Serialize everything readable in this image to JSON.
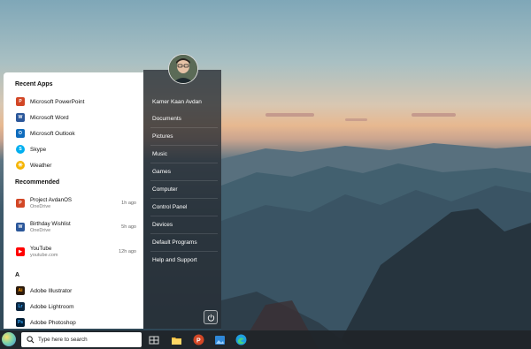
{
  "user": {
    "name": "Kamer Kaan Avdan"
  },
  "recent_apps": {
    "title": "Recent Apps",
    "items": [
      {
        "label": "Microsoft PowerPoint",
        "icon": "powerpoint-icon",
        "color": "#d24726",
        "glyph": "P"
      },
      {
        "label": "Microsoft Word",
        "icon": "word-icon",
        "color": "#2b579a",
        "glyph": "W"
      },
      {
        "label": "Microsoft Outlook",
        "icon": "outlook-icon",
        "color": "#0f6cbd",
        "glyph": "O"
      },
      {
        "label": "Skype",
        "icon": "skype-icon",
        "color": "#00aff0",
        "glyph": "S"
      },
      {
        "label": "Weather",
        "icon": "weather-icon",
        "color": "#f5b400",
        "glyph": "☀"
      }
    ]
  },
  "recommended": {
    "title": "Recommended",
    "items": [
      {
        "title": "Project AvdanOS",
        "subtitle": "OneDrive",
        "time": "1h ago",
        "icon": "powerpoint-file-icon",
        "color": "#d24726",
        "glyph": "P"
      },
      {
        "title": "Birthday Wishlist",
        "subtitle": "OneDrive",
        "time": "5h ago",
        "icon": "word-file-icon",
        "color": "#2b579a",
        "glyph": "W"
      },
      {
        "title": "YouTube",
        "subtitle": "youtube.com",
        "time": "12h ago",
        "icon": "youtube-icon",
        "color": "#ff0000",
        "glyph": "▶"
      }
    ]
  },
  "all_apps": {
    "letter": "A",
    "items": [
      {
        "label": "Adobe Illustrator",
        "icon": "illustrator-icon",
        "color": "#2b1a0c",
        "fg": "#ff9a00",
        "glyph": "Ai"
      },
      {
        "label": "Adobe Lightroom",
        "icon": "lightroom-icon",
        "color": "#0b2640",
        "fg": "#31a8ff",
        "glyph": "Lr"
      },
      {
        "label": "Adobe Photoshop",
        "icon": "photoshop-icon",
        "color": "#001e36",
        "fg": "#31a8ff",
        "glyph": "Ps"
      }
    ]
  },
  "nav": [
    {
      "label": "Kamer Kaan Avdan"
    },
    {
      "label": "Documents"
    },
    {
      "label": "Pictures"
    },
    {
      "label": "Music"
    },
    {
      "label": "Games"
    },
    {
      "label": "Computer"
    },
    {
      "label": "Control Panel"
    },
    {
      "label": "Devices"
    },
    {
      "label": "Default Programs"
    },
    {
      "label": "Help and Support"
    }
  ],
  "taskbar": {
    "search_placeholder": "Type here to search",
    "pinned": [
      {
        "icon": "task-view-icon"
      },
      {
        "icon": "file-explorer-icon"
      },
      {
        "icon": "powerpoint-icon"
      },
      {
        "icon": "photos-icon"
      },
      {
        "icon": "edge-icon"
      }
    ]
  }
}
